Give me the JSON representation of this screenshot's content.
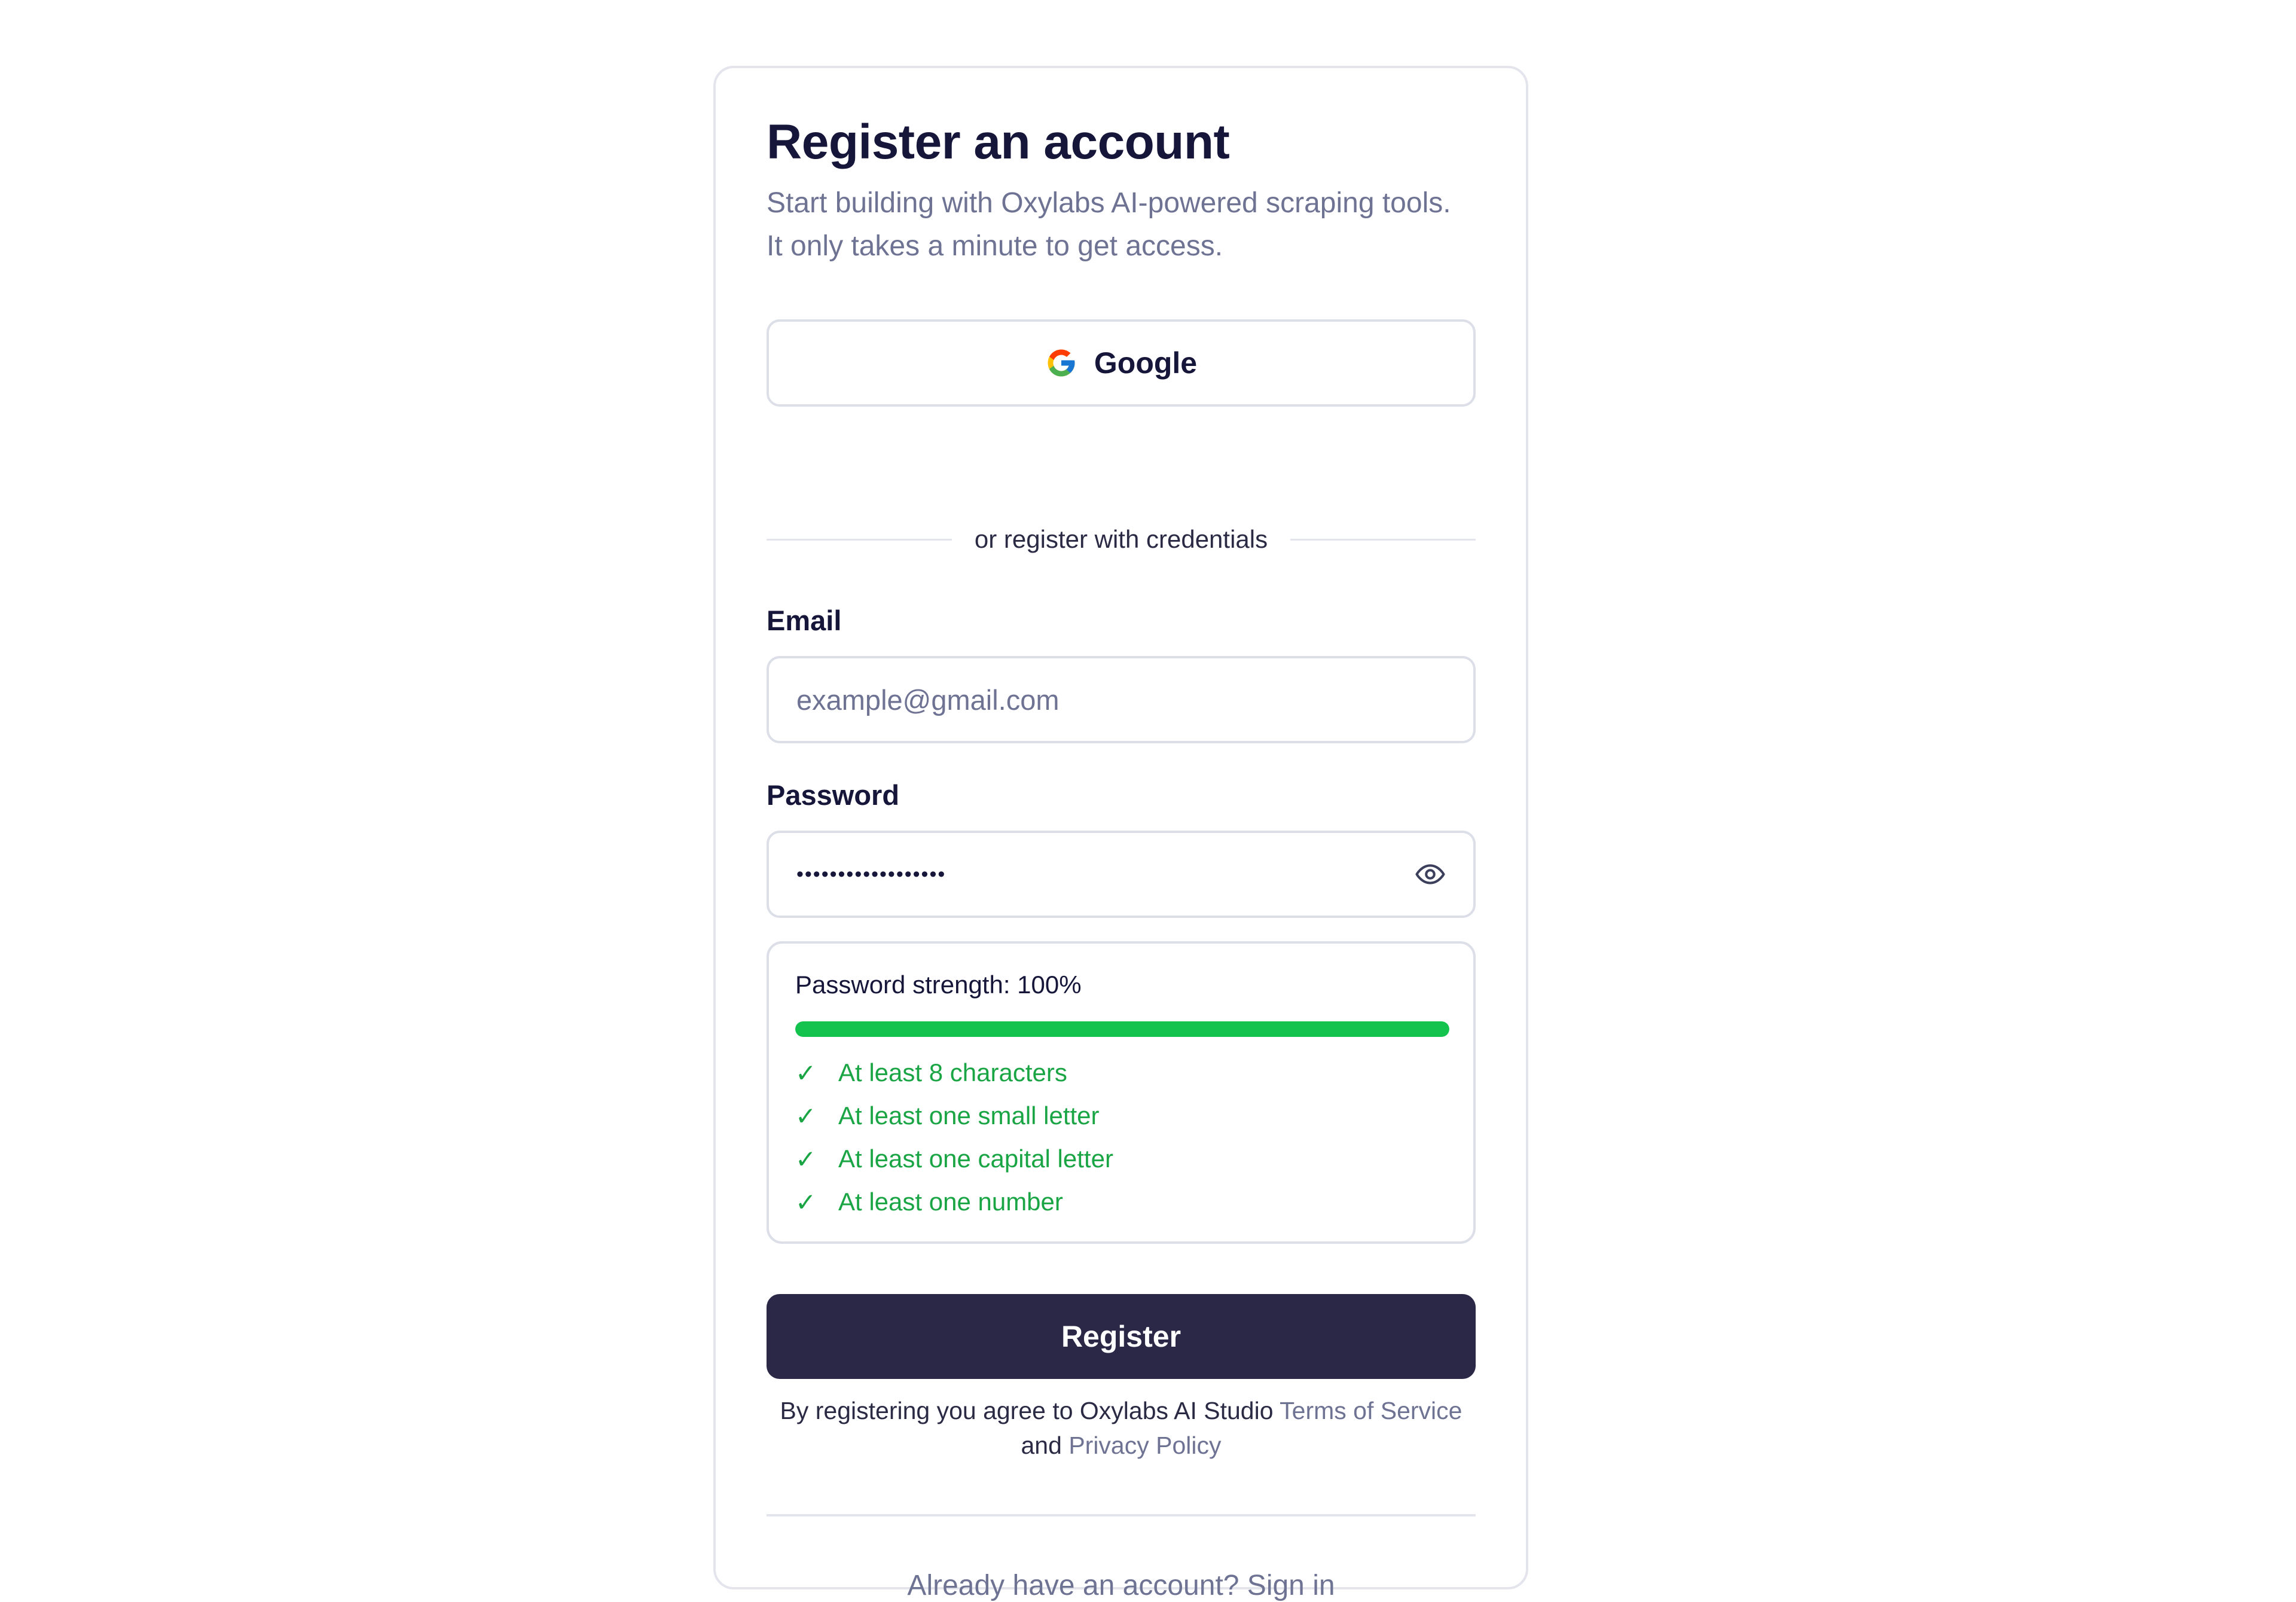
{
  "header": {
    "title": "Register an account",
    "subtitle": "Start building with Oxylabs AI-powered scraping tools. It only takes a minute to get access."
  },
  "oauth": {
    "google_label": "Google",
    "icon": "google-g-icon"
  },
  "divider_text": "or register with credentials",
  "email": {
    "label": "Email",
    "placeholder": "example@gmail.com",
    "value": ""
  },
  "password": {
    "label": "Password",
    "value": "••••••••••••••••••",
    "toggle_icon": "eye-icon"
  },
  "strength": {
    "label": "Password strength: 100%",
    "percent": 100,
    "color": "#14c24e",
    "requirements": [
      {
        "check": "✓",
        "text": "At least 8 characters"
      },
      {
        "check": "✓",
        "text": "At least one small letter"
      },
      {
        "check": "✓",
        "text": "At least one capital letter"
      },
      {
        "check": "✓",
        "text": "At least one number"
      }
    ]
  },
  "register_button": "Register",
  "terms": {
    "prefix": "By registering you agree to Oxylabs AI Studio ",
    "terms_link": "Terms of Service",
    "conjunction": " and ",
    "privacy_link": "Privacy Policy"
  },
  "signin_text": "Already have an account? Sign in",
  "colors": {
    "primary_button": "#2b2847",
    "success": "#14c24e",
    "muted_text": "#6f7393",
    "border": "#dcdee8"
  }
}
